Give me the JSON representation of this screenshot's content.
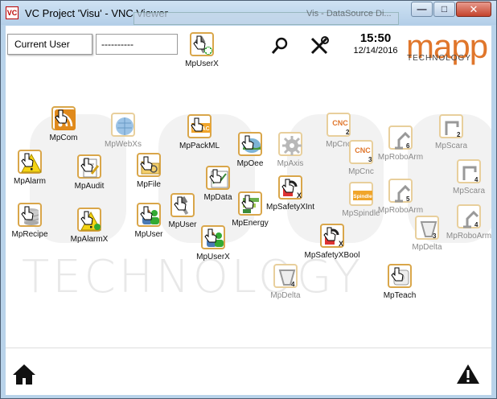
{
  "window": {
    "logo_text": "VC",
    "title": "VC Project 'Visu' - VNC Viewer",
    "background_tab_text": "Vis - DataSource Di..."
  },
  "header": {
    "current_user_label": "Current User",
    "current_user_value": "----------",
    "time": "15:50",
    "date": "12/14/2016",
    "brand": "mapp",
    "brand_sub": "TECHNOLOGY",
    "top_user_button": "MpUserX"
  },
  "watermark": {
    "text": "TECHNOLOGY"
  },
  "tiles": [
    {
      "label": "MpCom",
      "icon": "rss-icon",
      "enabled": true
    },
    {
      "label": "MpWebXs",
      "icon": "globe-icon",
      "enabled": false
    },
    {
      "label": "MpPackML",
      "icon": "omac-icon",
      "enabled": true
    },
    {
      "label": "MpOee",
      "icon": "landscape-icon",
      "enabled": true
    },
    {
      "label": "MpAxis",
      "icon": "gear-icon",
      "enabled": false
    },
    {
      "label": "MpCnc",
      "icon": "cnc2-icon",
      "enabled": false
    },
    {
      "label": "MpRoboArm",
      "icon": "roboarm6-icon",
      "enabled": false
    },
    {
      "label": "MpScara",
      "icon": "scara2-icon",
      "enabled": false
    },
    {
      "label": "MpAlarm",
      "icon": "warning-icon",
      "enabled": true
    },
    {
      "label": "MpAudit",
      "icon": "audit-icon",
      "enabled": true
    },
    {
      "label": "MpFile",
      "icon": "folder-icon",
      "enabled": true
    },
    {
      "label": "MpData",
      "icon": "data-icon",
      "enabled": true
    },
    {
      "label": "MpSafetyXInt",
      "icon": "safety-icon",
      "enabled": true
    },
    {
      "label": "MpCnc",
      "icon": "cnc3-icon",
      "enabled": false
    },
    {
      "label": "MpScara",
      "icon": "scara4-icon",
      "enabled": false
    },
    {
      "label": "MpRecipe",
      "icon": "database-icon",
      "enabled": true
    },
    {
      "label": "MpAlarmX",
      "icon": "warning-x-icon",
      "enabled": true
    },
    {
      "label": "MpUser",
      "icon": "users-icon",
      "enabled": true
    },
    {
      "label": "MpUser",
      "icon": "user-key-icon",
      "enabled": true
    },
    {
      "label": "MpEnergy",
      "icon": "energy-icon",
      "enabled": true
    },
    {
      "label": "MpSpindle",
      "icon": "spindle-icon",
      "enabled": false
    },
    {
      "label": "MpRoboArm",
      "icon": "roboarm5-icon",
      "enabled": false
    },
    {
      "label": "MpDelta",
      "icon": "delta3-icon",
      "enabled": false
    },
    {
      "label": "MpRoboArm",
      "icon": "roboarm4-icon",
      "enabled": false
    },
    {
      "label": "MpUserX",
      "icon": "users-x-icon",
      "enabled": true
    },
    {
      "label": "MpSafetyXBool",
      "icon": "safety-bool-icon",
      "enabled": true
    },
    {
      "label": "MpDelta",
      "icon": "delta4-icon",
      "enabled": false
    },
    {
      "label": "MpTeach",
      "icon": "teach-icon",
      "enabled": true
    }
  ],
  "badges": {
    "cnc2": "2",
    "cnc3": "3",
    "robo6": "6",
    "robo5": "5",
    "robo4": "4",
    "scara2": "2",
    "scara4": "4",
    "delta3": "3",
    "delta4": "4",
    "omac": "OMAC",
    "cnc": "CNC",
    "spindle": "Spindle",
    "x": "X"
  },
  "colors": {
    "accent": "#e0762b",
    "tile_border": "#d9a64a",
    "dim_text": "#8a8a8a"
  }
}
